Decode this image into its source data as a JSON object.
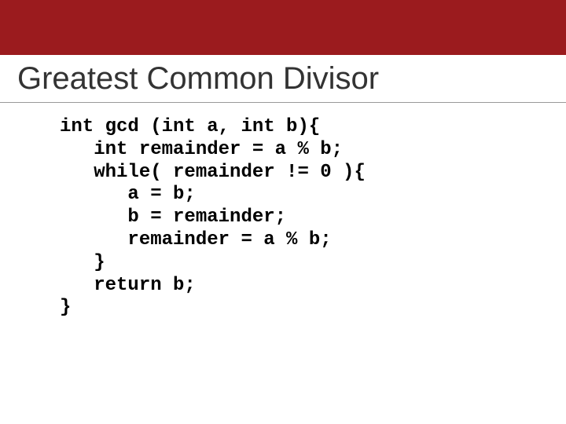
{
  "title": "Greatest Common Divisor",
  "code": "int gcd (int a, int b){\n   int remainder = a % b;\n   while( remainder != 0 ){\n      a = b;\n      b = remainder;\n      remainder = a % b;\n   }\n   return b;\n}"
}
